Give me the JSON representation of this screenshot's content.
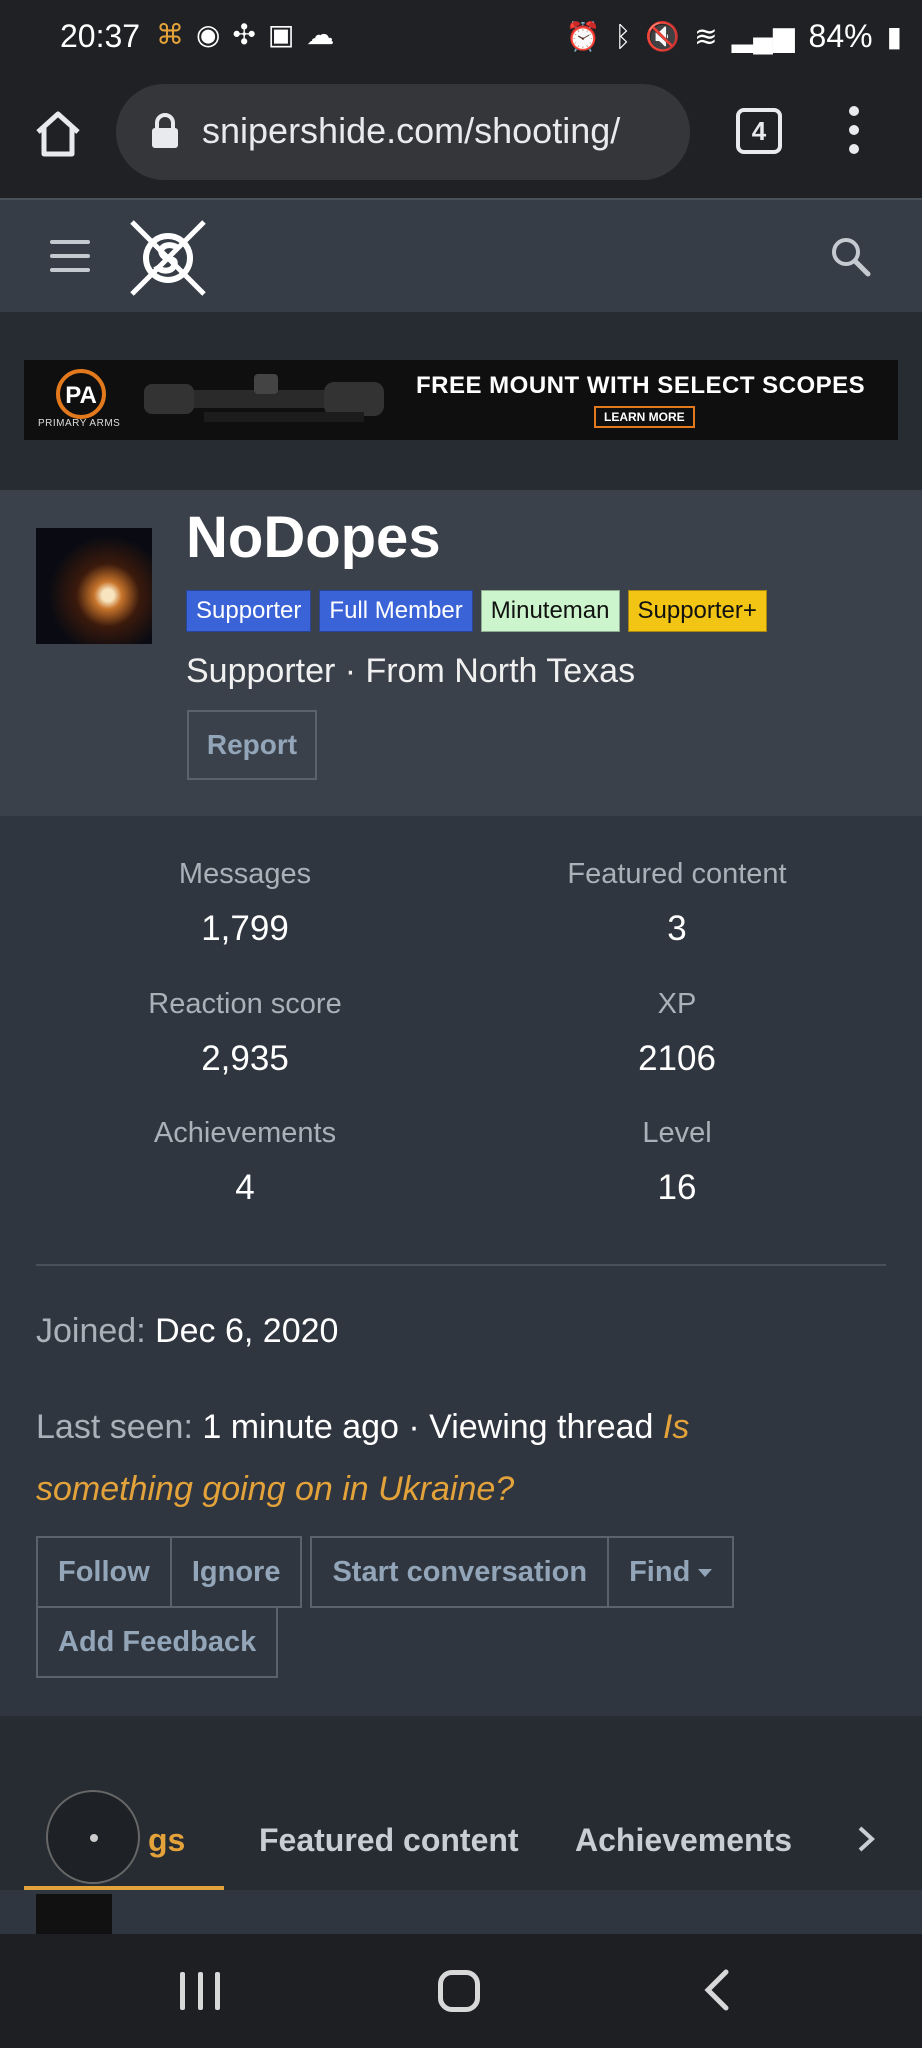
{
  "status_bar": {
    "time": "20:37",
    "left_icons": [
      "notification-icon",
      "app-icon",
      "fan-icon",
      "gallery-icon",
      "cloud-icon"
    ],
    "right_icons": [
      "alarm-icon",
      "bluetooth-icon",
      "mute-icon",
      "wifi-icon",
      "signal-icon"
    ],
    "battery": "84%"
  },
  "browser": {
    "url": "snipershide.com/shooting/",
    "tab_count": "4"
  },
  "ad": {
    "logo": "PA",
    "logo_sub": "PRIMARY ARMS",
    "headline": "FREE MOUNT WITH SELECT SCOPES",
    "cta": "LEARN MORE"
  },
  "profile": {
    "username": "NoDopes",
    "badges": [
      "Supporter",
      "Full Member",
      "Minuteman",
      "Supporter+"
    ],
    "subtitle": "Supporter · From North Texas",
    "report_label": "Report"
  },
  "stats": {
    "messages": {
      "label": "Messages",
      "value": "1,799"
    },
    "featured": {
      "label": "Featured content",
      "value": "3"
    },
    "reaction": {
      "label": "Reaction score",
      "value": "2,935"
    },
    "xp": {
      "label": "XP",
      "value": "2106"
    },
    "achievements": {
      "label": "Achievements",
      "value": "4"
    },
    "level": {
      "label": "Level",
      "value": "16"
    }
  },
  "info": {
    "joined_label": "Joined:",
    "joined_value": "Dec 6, 2020",
    "last_seen_label": "Last seen:",
    "last_seen_value": "1 minute ago · Viewing thread",
    "thread_line1": "Is",
    "thread_line2": "something going on in Ukraine?"
  },
  "actions": {
    "follow": "Follow",
    "ignore": "Ignore",
    "start_conversation": "Start conversation",
    "find": "Find",
    "add_feedback": "Add Feedback"
  },
  "tabs": {
    "active_partial": "gs",
    "featured": "Featured content",
    "achievements": "Achievements"
  },
  "colors": {
    "accent": "#e3a33a",
    "badge_blue": "#3a63d8",
    "badge_mint": "#ccf5cd",
    "badge_gold": "#f2c413"
  }
}
